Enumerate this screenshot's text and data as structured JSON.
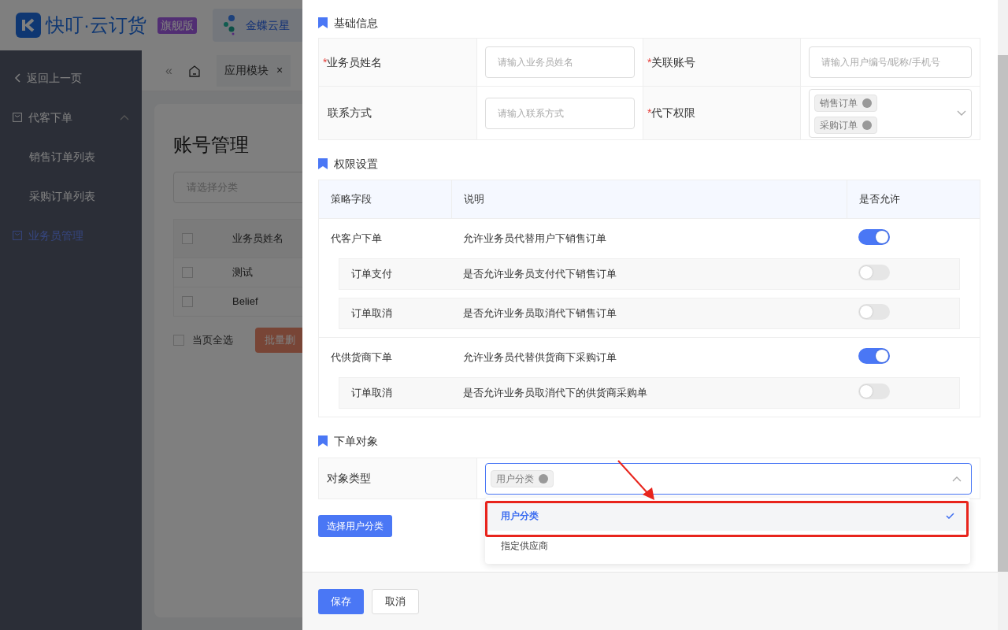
{
  "app": {
    "logo": "快叮·云订货",
    "edition": "旗舰版",
    "tenant": "金蝶云星"
  },
  "sidebar": {
    "back": "返回上一页",
    "items": [
      {
        "kind": "group",
        "label": "代客下单",
        "expanded": true,
        "selected": false,
        "children": [
          {
            "label": "销售订单列表",
            "selected": false
          },
          {
            "label": "采购订单列表",
            "selected": false
          }
        ]
      },
      {
        "kind": "link",
        "label": "业务员管理",
        "selected": true
      }
    ]
  },
  "collapse": "«",
  "tabs": [
    {
      "label": "应用模块",
      "close": "×"
    }
  ],
  "page": {
    "title": "账号管理",
    "filter_placeholder": "请选择分类",
    "header_checked": false,
    "columns": [
      "业务员姓名"
    ],
    "rows": [
      {
        "checked": false,
        "cells": [
          "测试"
        ]
      },
      {
        "checked": false,
        "cells": [
          "Belief"
        ]
      }
    ],
    "select_all": "当页全选",
    "select_all_checked": false,
    "bulk_delete": "批量删"
  },
  "drawer": {
    "basic": {
      "title": "基础信息",
      "required_mark": "*",
      "rows": [
        [
          {
            "kind": "input",
            "label": "业务员姓名",
            "required": true,
            "placeholder": "请输入业务员姓名"
          },
          {
            "kind": "input",
            "label": "关联账号",
            "required": true,
            "placeholder": "请输入用户编号/昵称/手机号"
          }
        ],
        [
          {
            "kind": "input",
            "label": "联系方式",
            "required": false,
            "placeholder": "请输入联系方式"
          },
          {
            "kind": "multiselect",
            "label": "代下权限",
            "required": true,
            "tags": [
              "销售订单",
              "采购订单"
            ]
          }
        ]
      ]
    },
    "permissions": {
      "title": "权限设置",
      "columns": [
        "策略字段",
        "说明",
        "是否允许"
      ],
      "groups": [
        {
          "name": "代客户下单",
          "desc": "允许业务员代替用户下销售订单",
          "on": true,
          "children": [
            {
              "name": "订单支付",
              "desc": "是否允许业务员支付代下销售订单",
              "on": false
            },
            {
              "name": "订单取消",
              "desc": "是否允许业务员取消代下销售订单",
              "on": false
            }
          ]
        },
        {
          "name": "代供货商下单",
          "desc": "允许业务员代替供货商下采购订单",
          "on": true,
          "children": [
            {
              "name": "订单取消",
              "desc": "是否允许业务员取消代下的供货商采购单",
              "on": false
            }
          ]
        }
      ]
    },
    "target": {
      "title": "下单对象",
      "label": "对象类型",
      "tags": [
        "用户分类"
      ],
      "open": true,
      "button": "选择用户分类",
      "options": [
        {
          "label": "用户分类",
          "selected": true
        },
        {
          "label": "指定供应商",
          "selected": false
        }
      ]
    },
    "footer": [
      {
        "kind": "primary",
        "label": "保存"
      },
      {
        "kind": "default",
        "label": "取消"
      }
    ]
  }
}
